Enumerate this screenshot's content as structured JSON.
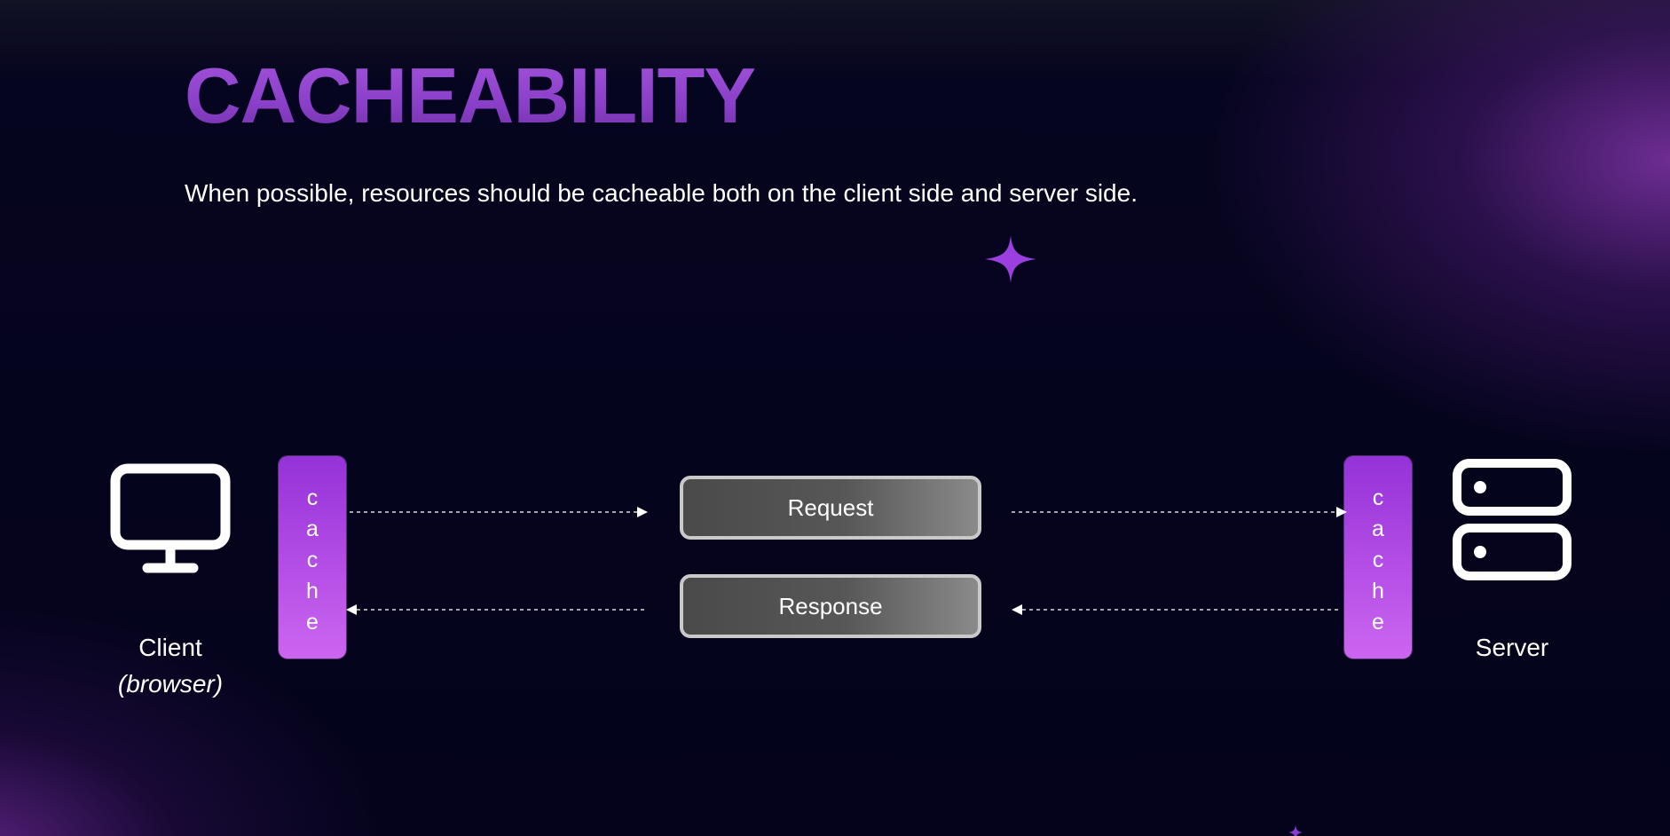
{
  "slide": {
    "title": "CACHEABILITY",
    "subtitle": "When possible, resources should be cacheable both on the client side and server side."
  },
  "diagram": {
    "client": {
      "label": "Client",
      "sublabel": "(browser)",
      "icon": "monitor-icon"
    },
    "server": {
      "label": "Server",
      "icon": "server-icon"
    },
    "cache_letters": [
      "c",
      "a",
      "c",
      "h",
      "e"
    ],
    "request_label": "Request",
    "response_label": "Response",
    "decorations": [
      "sparkle-icon"
    ]
  },
  "colors": {
    "background": "#05041c",
    "title_purple": "#9a4ad8",
    "cache_purple": "#b44ee6",
    "glow_purple": "#7a2fa8",
    "box_grey": "#555555",
    "box_border": "#c9c9c9",
    "text": "#ffffff"
  }
}
